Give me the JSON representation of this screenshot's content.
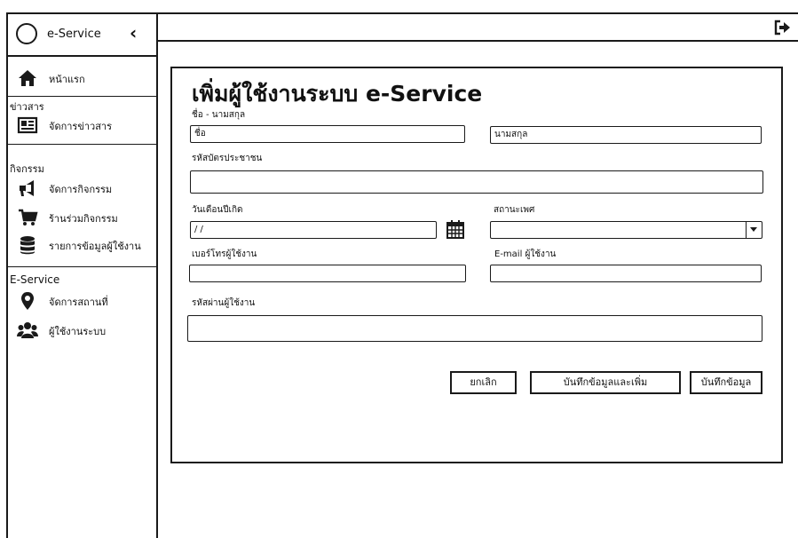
{
  "sidebar": {
    "brand_label": "e-Service",
    "collapse_icon": "chevron-left-icon",
    "home_label": "หน้าแรก",
    "news_section": "ข่าวสาร",
    "news_items": [
      {
        "label": "จัดการข่าวสาร",
        "icon": "newspaper-icon"
      }
    ],
    "activity_section": "กิจกรรม",
    "activity_items": [
      {
        "label": "จัดการกิจกรรม",
        "icon": "megaphone-icon"
      },
      {
        "label": "ร้านร่วมกิจกรรม",
        "icon": "cart-icon"
      },
      {
        "label": "รายการข้อมูลผู้ใช้งาน",
        "icon": "database-icon"
      }
    ],
    "eservice_section": "E-Service",
    "eservice_items": [
      {
        "label": "จัดการสถานที่",
        "icon": "map-marker-icon"
      },
      {
        "label": "ผู้ใช้งานระบบ",
        "icon": "users-icon"
      }
    ]
  },
  "header": {
    "logout_icon": "sign-out-icon"
  },
  "form": {
    "title": "เพิ่มผู้ใช้งานระบบ e-Service",
    "name_label": "ชื่อ - นามสกุล",
    "first_name_placeholder": "ชื่อ",
    "last_name_placeholder": "นามสกุล",
    "id_card_label": "รหัสบัตรประชาชน",
    "id_card_value": "",
    "birthdate_label": "วันเดือนปีเกิด",
    "birthdate_value": "/ /",
    "calendar_icon": "calendar-icon",
    "gender_label": "สถานะเพศ",
    "gender_value": "",
    "phone_label": "เบอร์โทรผู้ใช้งาน",
    "phone_value": "",
    "email_label": "E-mail ผู้ใช้งาน",
    "email_value": "",
    "password_label": "รหัสผ่านผู้ใช้งาน",
    "password_value": "",
    "cancel_label": "ยกเลิก",
    "save_and_add_label": "บันทึกข้อมูลและเพิ่ม",
    "save_label": "บันทึกข้อมูล"
  },
  "colors": {
    "ink": "#1a1a1a",
    "background": "#ffffff"
  }
}
